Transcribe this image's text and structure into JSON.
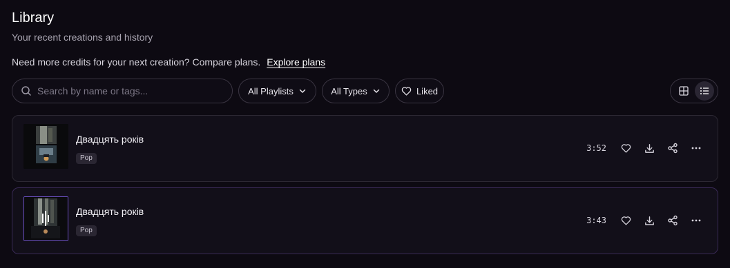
{
  "header": {
    "title": "Library",
    "subtitle": "Your recent creations and history"
  },
  "credits": {
    "text": "Need more credits for your next creation? Compare plans.",
    "link_label": "Explore plans"
  },
  "toolbar": {
    "search_placeholder": "Search by name or tags...",
    "playlists_filter": "All Playlists",
    "types_filter": "All Types",
    "liked_filter": "Liked",
    "view_mode": "list"
  },
  "tracks": [
    {
      "title": "Двадцять років",
      "tag": "Pop",
      "duration": "3:52",
      "selected": false
    },
    {
      "title": "Двадцять років",
      "tag": "Pop",
      "duration": "3:43",
      "selected": true
    }
  ],
  "colors": {
    "background": "#0d0a12",
    "row_background": "#120f19",
    "border": "#3a3542",
    "selected_border": "#6a4fc0"
  },
  "icons": {
    "search": "search-icon",
    "chevron": "chevron-down-icon",
    "heart": "heart-icon",
    "grid": "grid-view-icon",
    "list": "list-view-icon",
    "download": "download-icon",
    "share": "share-icon",
    "more": "more-icon"
  }
}
